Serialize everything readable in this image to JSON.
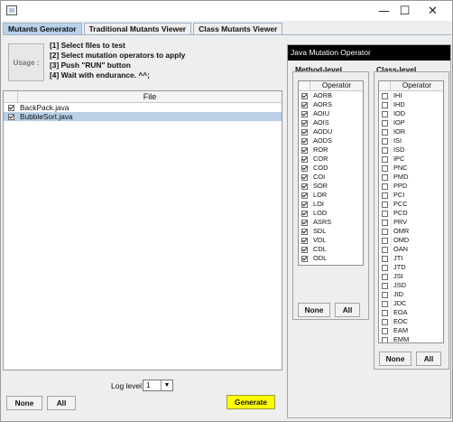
{
  "window": {
    "minimize_icon": "minimize-icon",
    "maximize_icon": "maximize-icon",
    "close_icon": "close-icon",
    "minimize_glyph": "—",
    "maximize_glyph": "☐",
    "close_glyph": "✕"
  },
  "tabs": [
    {
      "label": "Mutants Generator",
      "active": true
    },
    {
      "label": "Traditional Mutants Viewer",
      "active": false
    },
    {
      "label": "Class Mutants Viewer",
      "active": false
    }
  ],
  "usage": {
    "label": "Usage :",
    "steps": [
      "[1] Select files to test",
      "[2] Select mutation operators to apply",
      "[3] Push \"RUN\" button",
      "[4] Wait with endurance. ^^;"
    ]
  },
  "file_table": {
    "header": "File",
    "rows": [
      {
        "name": "BackPack.java",
        "checked": true,
        "selected": false
      },
      {
        "name": "BubbleSort.java",
        "checked": true,
        "selected": true
      }
    ]
  },
  "log_level": {
    "label": "Log level",
    "value": "1",
    "arrow": "▼"
  },
  "left_buttons": {
    "none": "None",
    "all": "All",
    "generate": "Generate"
  },
  "java_mutation_operator": {
    "title": "Java Mutation Operator",
    "method_level": {
      "title": "Method-level",
      "header": "Operator",
      "operators": [
        {
          "label": "AORB",
          "checked": true
        },
        {
          "label": "AORS",
          "checked": true
        },
        {
          "label": "AOIU",
          "checked": true
        },
        {
          "label": "AOIS",
          "checked": true
        },
        {
          "label": "AODU",
          "checked": true
        },
        {
          "label": "AODS",
          "checked": true
        },
        {
          "label": "ROR",
          "checked": true
        },
        {
          "label": "COR",
          "checked": true
        },
        {
          "label": "COD",
          "checked": true
        },
        {
          "label": "COI",
          "checked": true
        },
        {
          "label": "SOR",
          "checked": true
        },
        {
          "label": "LOR",
          "checked": true
        },
        {
          "label": "LOI",
          "checked": true
        },
        {
          "label": "LOD",
          "checked": true
        },
        {
          "label": "ASRS",
          "checked": true
        },
        {
          "label": "SDL",
          "checked": true
        },
        {
          "label": "VDL",
          "checked": true
        },
        {
          "label": "CDL",
          "checked": true
        },
        {
          "label": "ODL",
          "checked": true
        }
      ],
      "none": "None",
      "all": "All"
    },
    "class_level": {
      "title": "Class-level",
      "header": "Operator",
      "operators": [
        {
          "label": "IHI",
          "checked": false
        },
        {
          "label": "IHD",
          "checked": false
        },
        {
          "label": "IOD",
          "checked": false
        },
        {
          "label": "IOP",
          "checked": false
        },
        {
          "label": "IOR",
          "checked": false
        },
        {
          "label": "ISI",
          "checked": false
        },
        {
          "label": "ISD",
          "checked": false
        },
        {
          "label": "IPC",
          "checked": false
        },
        {
          "label": "PNC",
          "checked": false
        },
        {
          "label": "PMD",
          "checked": false
        },
        {
          "label": "PPD",
          "checked": false
        },
        {
          "label": "PCI",
          "checked": false
        },
        {
          "label": "PCC",
          "checked": false
        },
        {
          "label": "PCD",
          "checked": false
        },
        {
          "label": "PRV",
          "checked": false
        },
        {
          "label": "OMR",
          "checked": false
        },
        {
          "label": "OMD",
          "checked": false
        },
        {
          "label": "OAN",
          "checked": false
        },
        {
          "label": "JTI",
          "checked": false
        },
        {
          "label": "JTD",
          "checked": false
        },
        {
          "label": "JSI",
          "checked": false
        },
        {
          "label": "JSD",
          "checked": false
        },
        {
          "label": "JID",
          "checked": false
        },
        {
          "label": "JDC",
          "checked": false
        },
        {
          "label": "EOA",
          "checked": false
        },
        {
          "label": "EOC",
          "checked": false
        },
        {
          "label": "EAM",
          "checked": false
        },
        {
          "label": "EMM",
          "checked": false
        }
      ],
      "none": "None",
      "all": "All"
    }
  },
  "colors": {
    "active_tab": "#b9d1ea",
    "selected_row": "#b8cfe5",
    "generate_button": "#ffff00",
    "panel_title_bg": "#000000"
  }
}
